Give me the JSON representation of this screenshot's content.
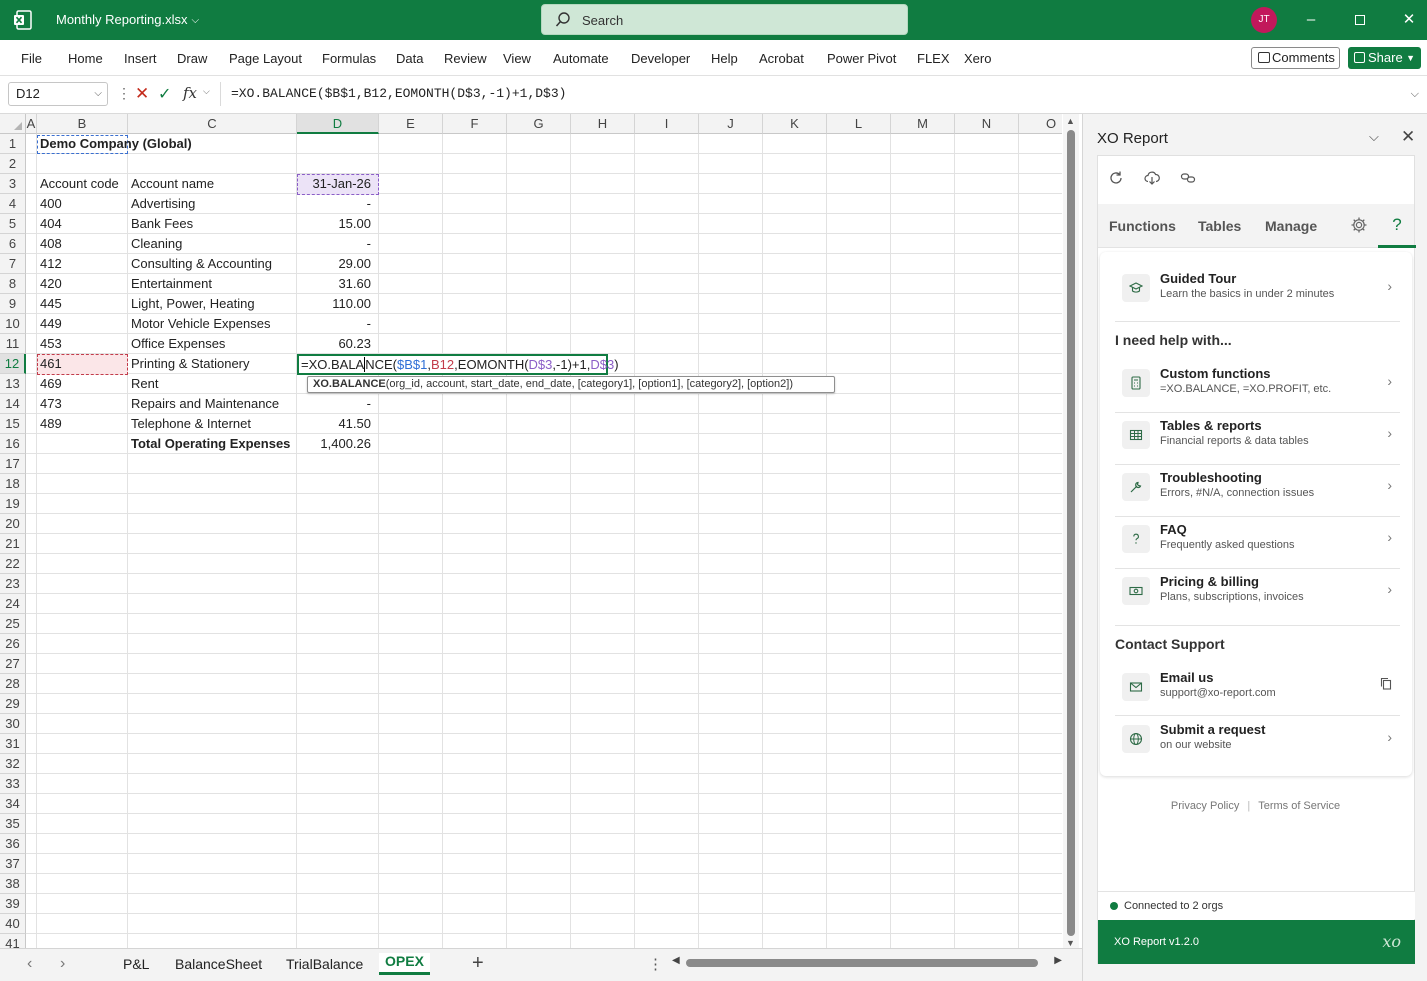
{
  "window": {
    "file_name": "Monthly Reporting.xlsx",
    "search_placeholder": "Search",
    "user_initials": "JT"
  },
  "ribbon": {
    "tabs": [
      "File",
      "Home",
      "Insert",
      "Draw",
      "Page Layout",
      "Formulas",
      "Data",
      "Review",
      "View",
      "Automate",
      "Developer",
      "Help",
      "Acrobat",
      "Power Pivot",
      "FLEX",
      "Xero"
    ],
    "comments_label": "Comments",
    "share_label": "Share"
  },
  "formula_bar": {
    "name_box": "D12",
    "formula": "=XO.BALANCE($B$1,B12,EOMONTH(D$3,-1)+1,D$3)"
  },
  "sheet": {
    "columns": [
      "A",
      "B",
      "C",
      "D",
      "E",
      "F",
      "G",
      "H",
      "I",
      "J",
      "K",
      "L",
      "M",
      "N",
      "O"
    ],
    "selected_column": "D",
    "selected_row": 12,
    "title": "Demo Company (Global)",
    "header": {
      "code": "Account code",
      "name": "Account name",
      "date": "31-Jan-26"
    },
    "rows": [
      {
        "row": 4,
        "code": "400",
        "name": "Advertising",
        "value": "-"
      },
      {
        "row": 5,
        "code": "404",
        "name": "Bank Fees",
        "value": "15.00"
      },
      {
        "row": 6,
        "code": "408",
        "name": "Cleaning",
        "value": "-"
      },
      {
        "row": 7,
        "code": "412",
        "name": "Consulting & Accounting",
        "value": "29.00"
      },
      {
        "row": 8,
        "code": "420",
        "name": "Entertainment",
        "value": "31.60"
      },
      {
        "row": 9,
        "code": "445",
        "name": "Light, Power, Heating",
        "value": "110.00"
      },
      {
        "row": 10,
        "code": "449",
        "name": "Motor Vehicle Expenses",
        "value": "-"
      },
      {
        "row": 11,
        "code": "453",
        "name": "Office Expenses",
        "value": "60.23"
      },
      {
        "row": 12,
        "code": "461",
        "name": "Printing & Stationery",
        "value": ""
      },
      {
        "row": 13,
        "code": "469",
        "name": "Rent",
        "value": ""
      },
      {
        "row": 14,
        "code": "473",
        "name": "Repairs and Maintenance",
        "value": "-"
      },
      {
        "row": 15,
        "code": "489",
        "name": "Telephone & Internet",
        "value": "41.50"
      }
    ],
    "total_label": "Total Operating Expenses",
    "total_value": "1,400.26",
    "editing": {
      "p1": "=XO.BALA",
      "p2": "NCE(",
      "ref1": "$B$1",
      "c1": ",",
      "ref2": "B12",
      "c2": ",EOMONTH(",
      "ref3": "D$3",
      "c3": ",-1)+1,",
      "ref4": "D$3",
      "c4": ")"
    },
    "tooltip_fn": "XO.BALANCE",
    "tooltip_args": "(org_id, account, start_date, end_date, [category1], [option1], [category2], [option2])"
  },
  "sheet_tabs": {
    "tabs": [
      "P&L",
      "BalanceSheet",
      "TrialBalance",
      "OPEX"
    ],
    "active": "OPEX",
    "add_label": "+"
  },
  "pane": {
    "title": "XO Report",
    "tabs": [
      "Functions",
      "Tables",
      "Manage"
    ],
    "guided_tour": {
      "title": "Guided Tour",
      "subtitle": "Learn the basics in under 2 minutes"
    },
    "help_heading": "I need help with...",
    "help_items": [
      {
        "title": "Custom functions",
        "subtitle": "=XO.BALANCE, =XO.PROFIT, etc."
      },
      {
        "title": "Tables & reports",
        "subtitle": "Financial reports & data tables"
      },
      {
        "title": "Troubleshooting",
        "subtitle": "Errors, #N/A, connection issues"
      },
      {
        "title": "FAQ",
        "subtitle": "Frequently asked questions"
      },
      {
        "title": "Pricing & billing",
        "subtitle": "Plans, subscriptions, invoices"
      }
    ],
    "support_heading": "Contact Support",
    "support_items": [
      {
        "title": "Email us",
        "subtitle": "support@xo-report.com"
      },
      {
        "title": "Submit a request",
        "subtitle": "on our website"
      }
    ],
    "privacy_label": "Privacy Policy",
    "terms_label": "Terms of Service",
    "status_text": "Connected to 2 orgs",
    "version_text": "XO Report v1.2.0",
    "logo_text": "xo"
  }
}
